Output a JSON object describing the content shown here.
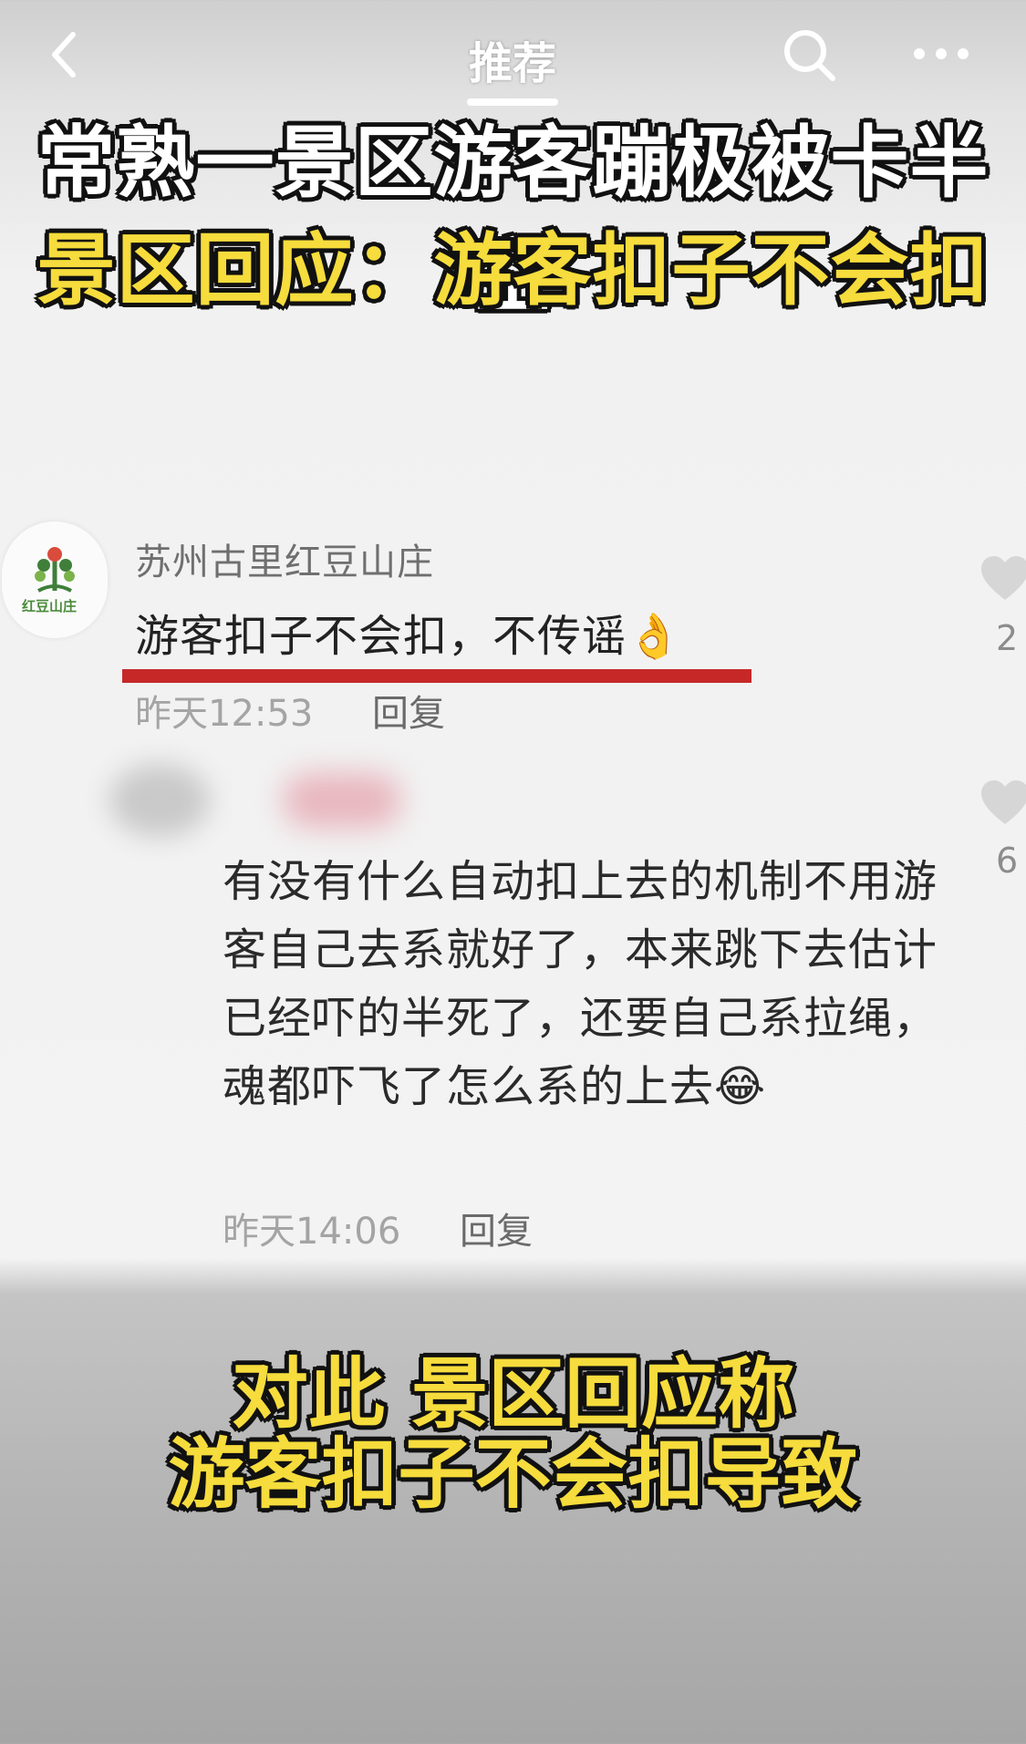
{
  "top_bar": {
    "tab_label": "推荐",
    "icons": [
      "back-arrow-icon",
      "search-icon",
      "more-dots-icon"
    ]
  },
  "headline": {
    "line1": "常熟一景区游客蹦极被卡半空",
    "line2": "景区回应：游客扣子不会扣"
  },
  "comments": [
    {
      "author": "苏州古里红豆山庄",
      "avatar_logo_text": "红豆山庄",
      "text": "游客扣子不会扣，不传谣👌",
      "time": "昨天12:53",
      "reply_label": "回复",
      "likes": "2"
    },
    {
      "author": "",
      "text": "有没有什么自动扣上去的机制不用游客自己去系就好了，本来跳下去估计已经吓的半死了，还要自己系拉绳，魂都吓飞了怎么系的上去😂",
      "time": "昨天14:06",
      "reply_label": "回复",
      "likes": "6"
    }
  ],
  "caption": {
    "line1": "对此 景区回应称",
    "line2": "游客扣子不会扣导致"
  },
  "colors": {
    "headline_yellow": "#f6dc3c",
    "underline_red": "#c62828",
    "like_gray": "#d6d6d6"
  }
}
